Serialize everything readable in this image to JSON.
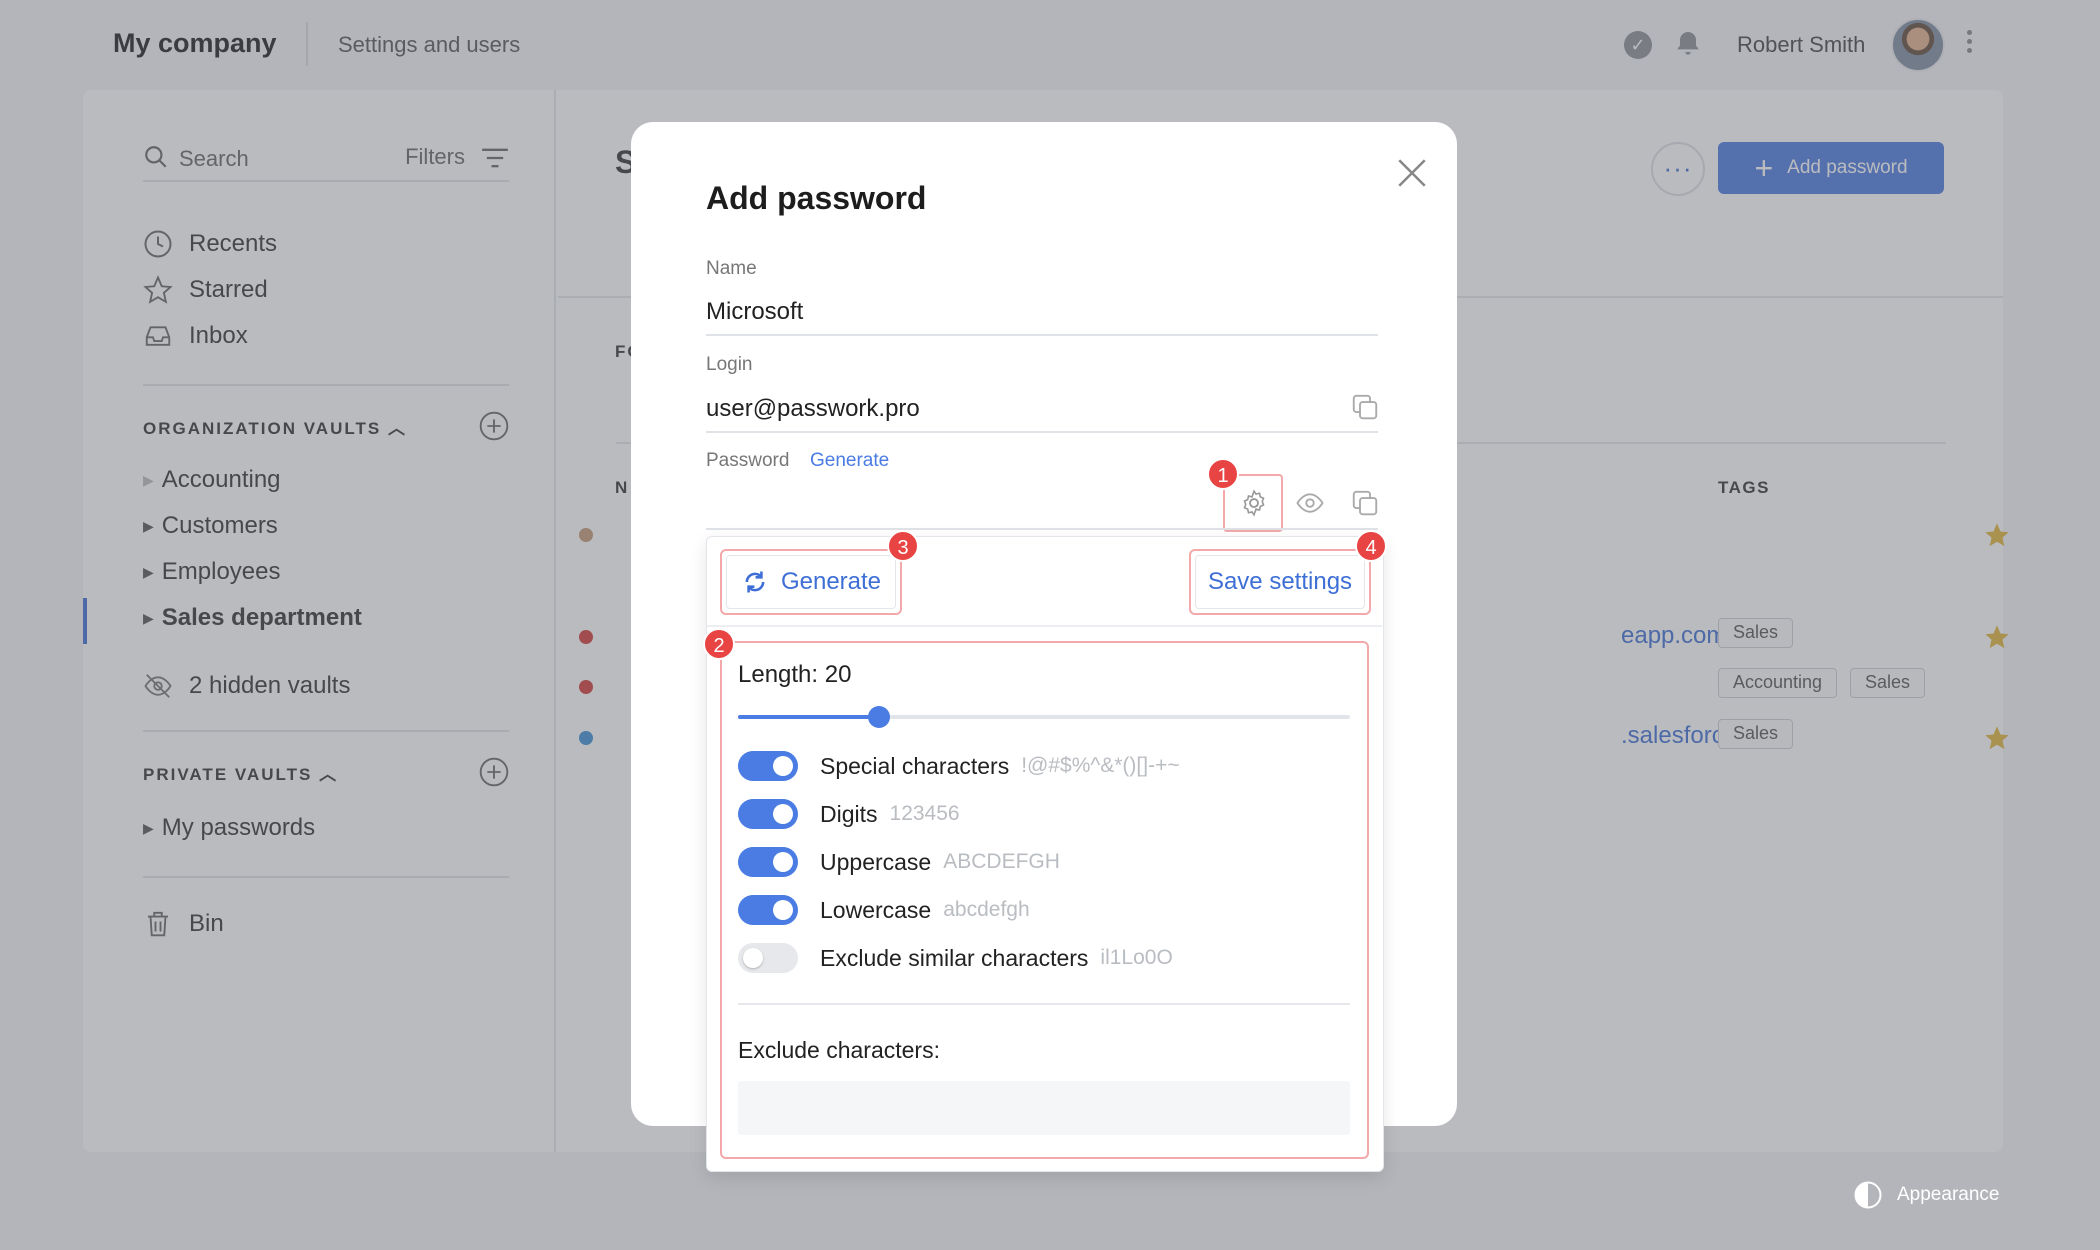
{
  "topbar": {
    "company": "My company",
    "settings_link": "Settings and users",
    "user_name": "Robert Smith"
  },
  "sidebar": {
    "search_placeholder": "Search",
    "filters_label": "Filters",
    "nav": [
      {
        "label": "Recents",
        "icon": "clock-icon"
      },
      {
        "label": "Starred",
        "icon": "star-icon"
      },
      {
        "label": "Inbox",
        "icon": "inbox-icon"
      }
    ],
    "org_section": "ORGANIZATION VAULTS",
    "org_vaults": [
      "Accounting",
      "Customers",
      "Employees",
      "Sales department"
    ],
    "active_vault": "Sales department",
    "hidden_vaults": "2 hidden vaults",
    "private_section": "PRIVATE VAULTS",
    "private_vaults": [
      "My passwords"
    ],
    "bin": "Bin"
  },
  "content": {
    "heading_fragment": "S",
    "folders_fragment": "FO",
    "name_col_fragment": "N",
    "tags_header": "TAGS",
    "add_password_label": "Add password",
    "rows": [
      {
        "url": "",
        "tags": [],
        "starred": true,
        "dot_color": "#c49a76"
      },
      {
        "url": "eapp.com",
        "tags": [
          "Sales"
        ],
        "starred": true,
        "dot_color": "#d23b3b"
      },
      {
        "url": "",
        "tags": [
          "Accounting",
          "Sales"
        ],
        "starred": false,
        "dot_color": "#d23b3b"
      },
      {
        "url": ".salesforce.c...",
        "tags": [
          "Sales"
        ],
        "starred": true,
        "dot_color": "#3b8fd6"
      }
    ]
  },
  "modal": {
    "title": "Add password",
    "name_label": "Name",
    "name_value": "Microsoft",
    "login_label": "Login",
    "login_value": "user@passwork.pro",
    "password_label": "Password",
    "generate_link": "Generate"
  },
  "generator": {
    "generate_button": "Generate",
    "save_settings_button": "Save settings",
    "length_label": "Length: 20",
    "length_value": 20,
    "length_fraction": 0.23,
    "options": [
      {
        "name": "Special characters",
        "sample": "!@#$%^&*()[]-+~",
        "enabled": true
      },
      {
        "name": "Digits",
        "sample": "123456",
        "enabled": true
      },
      {
        "name": "Uppercase",
        "sample": "ABCDEFGH",
        "enabled": true
      },
      {
        "name": "Lowercase",
        "sample": "abcdefgh",
        "enabled": true
      },
      {
        "name": "Exclude similar characters",
        "sample": "il1Lo0O",
        "enabled": false
      }
    ],
    "exclude_label": "Exclude characters:",
    "exclude_value": ""
  },
  "badges": [
    "1",
    "2",
    "3",
    "4"
  ],
  "footer": {
    "appearance": "Appearance"
  },
  "colors": {
    "accent": "#4a7ce3",
    "badge": "#e84444",
    "highlight": "#f3a9a9",
    "star": "#e0b43a"
  }
}
